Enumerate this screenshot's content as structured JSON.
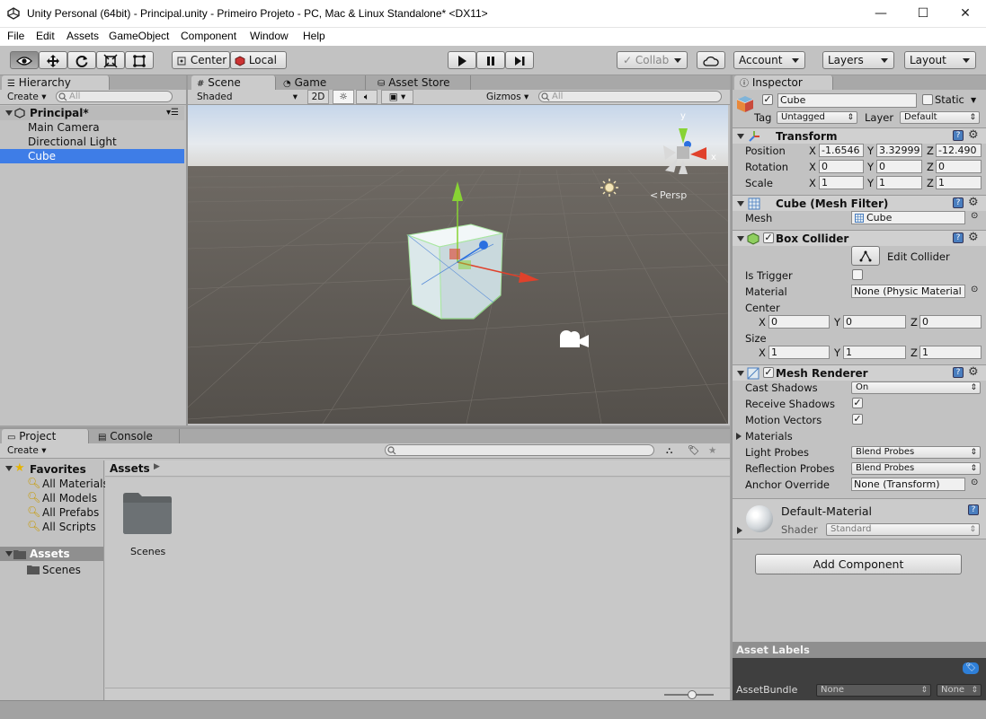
{
  "window": {
    "title": "Unity Personal (64bit) - Principal.unity - Primeiro Projeto - PC, Mac & Linux Standalone* <DX11>",
    "minimize": "—",
    "maximize": "☐",
    "close": "✕"
  },
  "menu": [
    "File",
    "Edit",
    "Assets",
    "GameObject",
    "Component",
    "Window",
    "Help"
  ],
  "toolbar": {
    "pivot": "Center",
    "space": "Local",
    "collab": "Collab",
    "account": "Account",
    "layers": "Layers",
    "layout": "Layout"
  },
  "hierarchy": {
    "tab": "Hierarchy",
    "create": "Create",
    "search_placeholder": "All",
    "scene": "Principal*",
    "items": [
      "Main Camera",
      "Directional Light",
      "Cube"
    ]
  },
  "scene": {
    "tabs": [
      "Scene",
      "Game",
      "Asset Store"
    ],
    "shading": "Shaded",
    "mode2d": "2D",
    "gizmos": "Gizmos",
    "search_placeholder": "All",
    "persp": "Persp",
    "axis_x": "x",
    "axis_y": "y"
  },
  "project": {
    "tabs": [
      "Project",
      "Console"
    ],
    "create": "Create",
    "favorites_label": "Favorites",
    "favorites": [
      "All Materials",
      "All Models",
      "All Prefabs",
      "All Scripts"
    ],
    "assets_label": "Assets",
    "assets_children": [
      "Scenes"
    ],
    "breadcrumb": "Assets",
    "folders": [
      "Scenes"
    ]
  },
  "inspector": {
    "tab": "Inspector",
    "object_name": "Cube",
    "static_label": "Static",
    "tag_label": "Tag",
    "tag_value": "Untagged",
    "layer_label": "Layer",
    "layer_value": "Default",
    "transform": {
      "title": "Transform",
      "position_label": "Position",
      "rotation_label": "Rotation",
      "scale_label": "Scale",
      "x": "X",
      "y": "Y",
      "z": "Z",
      "position": [
        "-1.6546",
        "3.32999",
        "-12.490"
      ],
      "rotation": [
        "0",
        "0",
        "0"
      ],
      "scale": [
        "1",
        "1",
        "1"
      ]
    },
    "mesh_filter": {
      "title": "Cube (Mesh Filter)",
      "mesh_label": "Mesh",
      "mesh_value": "Cube"
    },
    "box_collider": {
      "title": "Box Collider",
      "edit": "Edit Collider",
      "is_trigger_label": "Is Trigger",
      "material_label": "Material",
      "material_value": "None (Physic Material",
      "center_label": "Center",
      "center": [
        "0",
        "0",
        "0"
      ],
      "size_label": "Size",
      "size": [
        "1",
        "1",
        "1"
      ]
    },
    "mesh_renderer": {
      "title": "Mesh Renderer",
      "cast_shadows_label": "Cast Shadows",
      "cast_shadows_value": "On",
      "receive_shadows_label": "Receive Shadows",
      "motion_vectors_label": "Motion Vectors",
      "materials_label": "Materials",
      "light_probes_label": "Light Probes",
      "light_probes_value": "Blend Probes",
      "reflection_probes_label": "Reflection Probes",
      "reflection_probes_value": "Blend Probes",
      "anchor_override_label": "Anchor Override",
      "anchor_override_value": "None (Transform)"
    },
    "material": {
      "name": "Default-Material",
      "shader_label": "Shader",
      "shader_value": "Standard"
    },
    "add_component": "Add Component",
    "asset_labels": "Asset Labels",
    "asset_bundle_label": "AssetBundle",
    "asset_bundle_value": "None",
    "asset_bundle_variant": "None"
  },
  "colors": {
    "selection": "#3e7de7",
    "panel": "#c2c2c2",
    "scene_ground": "#5b5550",
    "sky": "#dfe6ee"
  }
}
